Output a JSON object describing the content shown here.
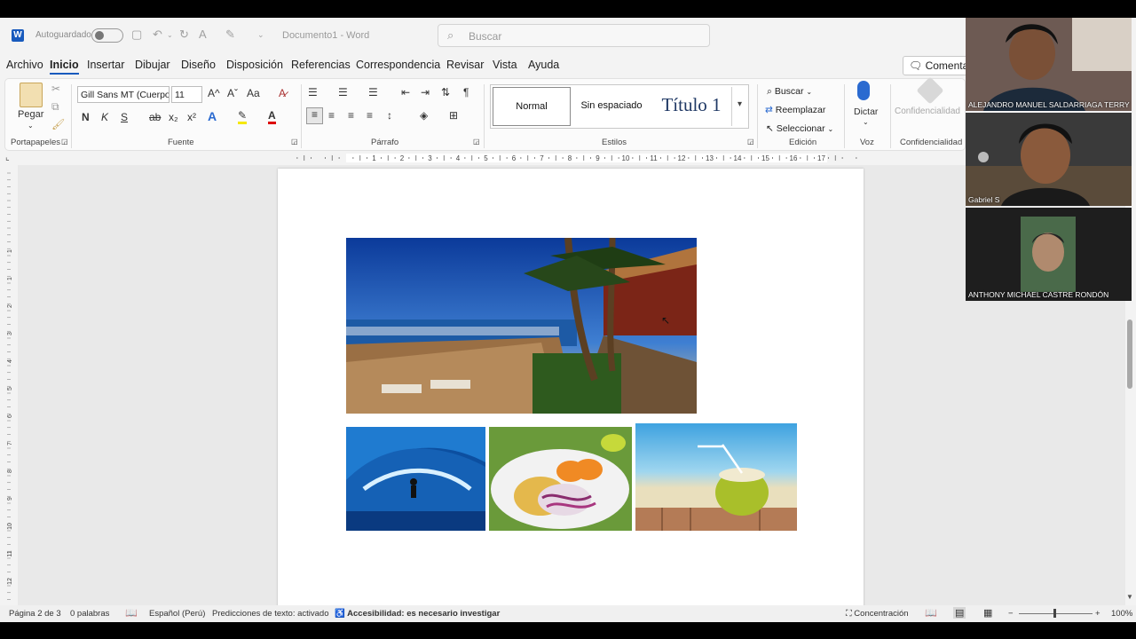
{
  "titlebar": {
    "app_icon": "W",
    "autosave_label": "Autoguardado",
    "document_title": "Documento1",
    "app_name": "Word",
    "title_separator": "-",
    "search_placeholder": "Buscar"
  },
  "tabs": [
    "Archivo",
    "Inicio",
    "Insertar",
    "Dibujar",
    "Diseño",
    "Disposición",
    "Referencias",
    "Correspondencia",
    "Revisar",
    "Vista",
    "Ayuda"
  ],
  "active_tab": "Inicio",
  "comments_button": "Comentari",
  "ribbon": {
    "clipboard": {
      "paste_label": "Pegar",
      "group_label": "Portapapeles"
    },
    "font": {
      "font_name": "Gill Sans MT (Cuerpo",
      "font_size": "11",
      "group_label": "Fuente",
      "bold": "N",
      "italic": "K",
      "underline": "S",
      "strike": "ab",
      "sub": "x₂",
      "sup": "x²",
      "grow": "A^",
      "shrink": "Aˇ",
      "case": "Aa"
    },
    "paragraph": {
      "group_label": "Párrafo",
      "pilcrow": "¶"
    },
    "styles": {
      "group_label": "Estilos",
      "items": [
        "Normal",
        "Sin espaciado",
        "Título 1"
      ]
    },
    "editing": {
      "group_label": "Edición",
      "buscar": "Buscar",
      "reemplazar": "Reemplazar",
      "seleccionar": "Seleccionar"
    },
    "voice": {
      "group_label": "Voz",
      "dictar": "Dictar"
    },
    "sensitivity": {
      "group_label": "Confidencialidad",
      "button_label": "Confidencialidad"
    }
  },
  "ruler": {
    "h_ticks": [
      "1",
      "2",
      "3",
      "4",
      "5",
      "6",
      "7",
      "8",
      "9",
      "10",
      "11",
      "12",
      "13",
      "14",
      "15",
      "16",
      "17"
    ],
    "v_ticks": [
      "1",
      "1",
      "2",
      "3",
      "4",
      "5",
      "6",
      "7",
      "8",
      "9",
      "10",
      "11",
      "12",
      "13"
    ]
  },
  "images": [
    {
      "name": "beach-resort-photo",
      "description": "beach"
    },
    {
      "name": "surfer-photo",
      "description": "surf"
    },
    {
      "name": "ceviche-photo",
      "description": "ceviche"
    },
    {
      "name": "coconut-drink-photo",
      "description": "coconut"
    }
  ],
  "statusbar": {
    "page": "Página 2 de 3",
    "words": "0 palabras",
    "language": "Español (Perú)",
    "prediction": "Predicciones de texto: activado",
    "accessibility": "Accesibilidad: es necesario investigar",
    "focus": "Concentración",
    "zoom": "100%"
  },
  "participants": [
    {
      "name": "ALEJANDRO MANUEL SALDARRIAGA TERRY"
    },
    {
      "name": "Gabriel S"
    },
    {
      "name": "ANTHONY MICHAEL CASTRE RONDÓN"
    }
  ],
  "colors": {
    "accent": "#185abd",
    "ribbon_bg": "#fbfbfb",
    "frame_bg": "#f3f3f3",
    "page_bg": "#ffffff"
  }
}
